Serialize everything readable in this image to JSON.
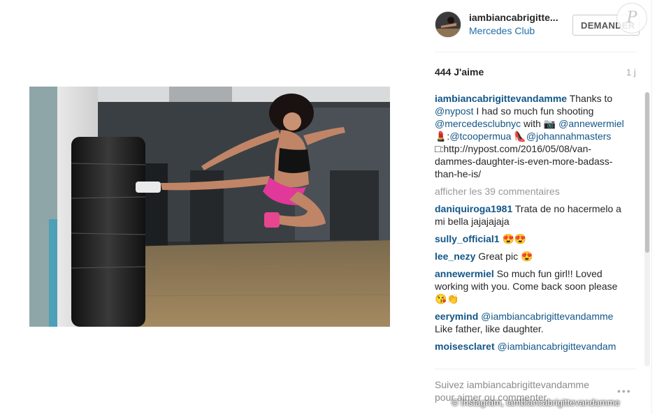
{
  "post": {
    "username": "iambiancabrigitte...",
    "location": "Mercedes Club",
    "follow_label": "DEMANDER",
    "likes": "444 J'aime",
    "age": "1 j",
    "more_comments": "afficher les 39 commentaires",
    "login_prompt": "Suivez iambiancabrigittevandamme pour aimer ou commenter.",
    "more_options": "•••"
  },
  "caption": {
    "user": "iambiancabrigittevandamme",
    "t1": " Thanks to ",
    "m1": "@nypost",
    "t2": " I had so much fun shooting ",
    "m2": "@mercedesclubnyc",
    "t3": " with 📷 ",
    "m3": "@annewermiel",
    "t4": " 💄:",
    "m4": "@tcoopermua",
    "t5": " 👠",
    "m5": "@johannahmasters",
    "t6": " □:http://nypost.com/2016/05/08/van-dammes-daughter-is-even-more-badass-than-he-is/"
  },
  "comments": [
    {
      "user": "daniquiroga1981",
      "text": " Trata de no hacermelo a mi bella jajajajaja"
    },
    {
      "user": "sully_official1",
      "text": " 😍😍"
    },
    {
      "user": "lee_nezy",
      "text": " Great pic 😍"
    },
    {
      "user": "annewermiel",
      "text": " So much fun girl!! Loved working with you. Come back soon please 😘👏"
    },
    {
      "user": "eerymind",
      "mention": " @iambiancabrigittevandamme",
      "text": " Like father, like daughter."
    },
    {
      "user": "moisesclaret",
      "mention": " @iambiancabrigittevandam",
      "text": ""
    }
  ],
  "watermark": {
    "logo_letter": "P",
    "credit": "© Instagram, iambiancabrigittevandamme"
  },
  "icons": [
    "avatar-photo",
    "instagram-photo",
    "more-options-icon",
    "publisher-logo-icon"
  ]
}
